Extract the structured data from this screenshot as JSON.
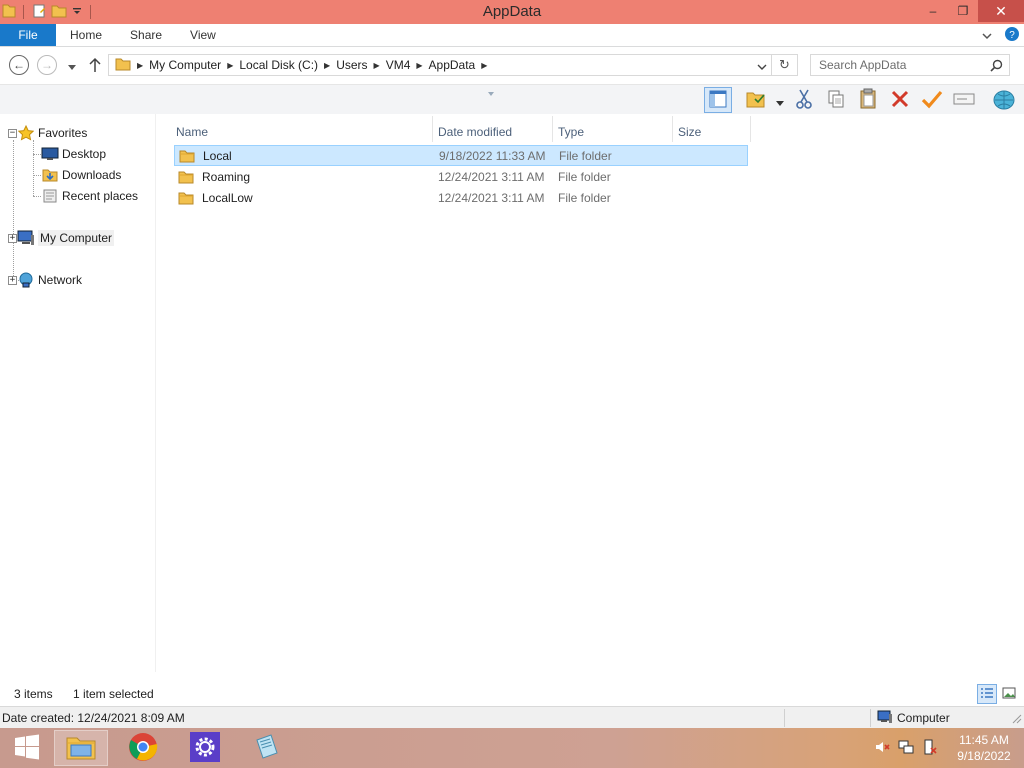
{
  "window": {
    "title": "AppData",
    "qat_icons": [
      "properties-icon",
      "new-folder-icon",
      "qat-dropdown-icon"
    ],
    "controls": [
      "minimize",
      "maximize",
      "close"
    ],
    "accent": "#ee8072"
  },
  "ribbon": {
    "tabs": [
      "File",
      "Home",
      "Share",
      "View"
    ],
    "file_color": "#1979ca"
  },
  "address": {
    "crumbs": [
      "My Computer",
      "Local Disk (C:)",
      "Users",
      "VM4",
      "AppData"
    ],
    "search_placeholder": "Search AppData"
  },
  "toolbar": {
    "buttons": [
      "preview-pane-icon",
      "select-icon",
      "cut-icon",
      "copy-icon",
      "paste-icon",
      "delete-icon",
      "check-icon",
      "rename-icon",
      "globe-icon"
    ]
  },
  "nav": {
    "favorites": "Favorites",
    "fav_items": [
      "Desktop",
      "Downloads",
      "Recent places"
    ],
    "computer": "My Computer",
    "network": "Network"
  },
  "columns": [
    "Name",
    "Date modified",
    "Type",
    "Size"
  ],
  "files": [
    {
      "name": "Local",
      "date": "9/18/2022 11:33 AM",
      "type": "File folder",
      "selected": true
    },
    {
      "name": "Roaming",
      "date": "12/24/2021 3:11 AM",
      "type": "File folder",
      "selected": false
    },
    {
      "name": "LocalLow",
      "date": "12/24/2021 3:11 AM",
      "type": "File folder",
      "selected": false
    }
  ],
  "status": {
    "count": "3 items",
    "selected": "1 item selected"
  },
  "details": {
    "date_created": "Date created: 12/24/2021 8:09 AM",
    "location": "Computer"
  },
  "taskbar": {
    "apps": [
      "file-explorer-icon",
      "chrome-icon",
      "settings-icon",
      "notepad-icon"
    ],
    "time": "11:45 AM",
    "date": "9/18/2022"
  }
}
